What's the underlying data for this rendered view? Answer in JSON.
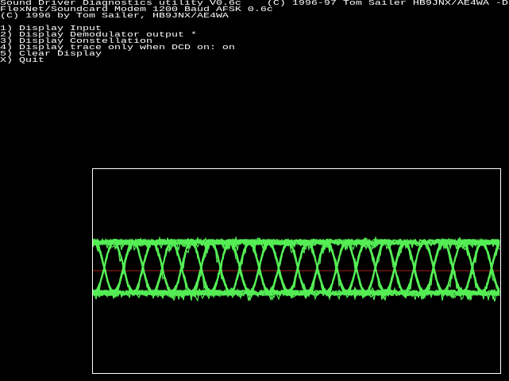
{
  "header": {
    "line1": "Sound Driver Diagnostics utility V0.6c    (C) 1996-97 Tom Sailer HB9JNX/AE4WA -D",
    "line2": "FlexNet/Soundcard Modem 1200 Baud AFSK 0.6c",
    "line3": "(C) 1996 by Tom Sailer, HB9JNX/AE4WA"
  },
  "menu": [
    {
      "label": "1) Display Input"
    },
    {
      "label": "2) Display Demodulator output *"
    },
    {
      "label": "3) Display Constellation"
    },
    {
      "label": "4) Display trace only when DCD on: on"
    },
    {
      "label": "5) Clear Display"
    },
    {
      "label": "X) Quit"
    }
  ],
  "scope": {
    "mode": "Demodulator output (eye diagram)",
    "trace_color": "#55ee55",
    "center_line_color": "#aa2222"
  }
}
